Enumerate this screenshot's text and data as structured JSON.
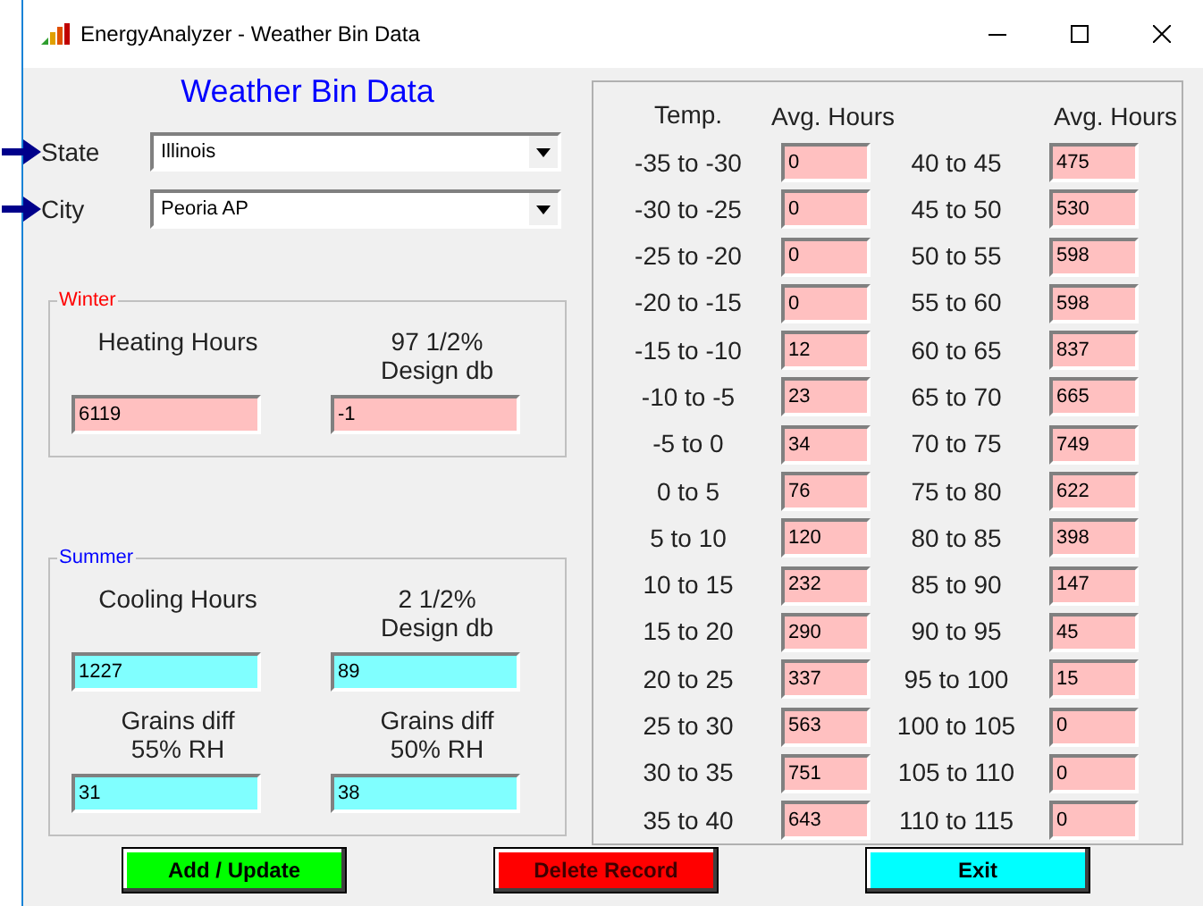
{
  "window": {
    "title": "EnergyAnalyzer - Weather Bin Data"
  },
  "heading": "Weather Bin Data",
  "selectors": [
    {
      "label": "State",
      "value": "Illinois"
    },
    {
      "label": "City",
      "value": "Peoria AP"
    }
  ],
  "groups": [
    {
      "title": "Winter",
      "kind": "winter",
      "fields": [
        {
          "label": "Heating Hours",
          "value": "6119"
        },
        {
          "label": "97 1/2%\nDesign db",
          "value": "-1"
        }
      ]
    },
    {
      "title": "Summer",
      "kind": "summer",
      "fields": [
        {
          "label": "Cooling Hours",
          "value": "1227"
        },
        {
          "label": "2 1/2%\nDesign db",
          "value": "89"
        },
        {
          "label": "Grains diff\n55% RH",
          "value": "31"
        },
        {
          "label": "Grains diff\n50% RH",
          "value": "38"
        }
      ]
    }
  ],
  "bins": {
    "headers": [
      "Temp.",
      "Avg. Hours",
      "Avg. Hours"
    ],
    "rows": [
      {
        "range": "-35 to -30",
        "hours": "0"
      },
      {
        "range": "-30 to -25",
        "hours": "0"
      },
      {
        "range": "-25 to -20",
        "hours": "0"
      },
      {
        "range": "-20 to -15",
        "hours": "0"
      },
      {
        "range": "-15 to -10",
        "hours": "12"
      },
      {
        "range": "-10 to -5",
        "hours": "23"
      },
      {
        "range": "-5 to 0",
        "hours": "34"
      },
      {
        "range": "0 to 5",
        "hours": "76"
      },
      {
        "range": "5 to 10",
        "hours": "120"
      },
      {
        "range": "10 to 15",
        "hours": "232"
      },
      {
        "range": "15 to 20",
        "hours": "290"
      },
      {
        "range": "20 to 25",
        "hours": "337"
      },
      {
        "range": "25 to 30",
        "hours": "563"
      },
      {
        "range": "30 to 35",
        "hours": "751"
      },
      {
        "range": "35 to 40",
        "hours": "643"
      },
      {
        "range": "40 to 45",
        "hours": "475"
      },
      {
        "range": "45 to 50",
        "hours": "530"
      },
      {
        "range": "50 to 55",
        "hours": "598"
      },
      {
        "range": "55 to 60",
        "hours": "598"
      },
      {
        "range": "60 to 65",
        "hours": "837"
      },
      {
        "range": "65 to 70",
        "hours": "665"
      },
      {
        "range": "70 to 75",
        "hours": "749"
      },
      {
        "range": "75 to 80",
        "hours": "622"
      },
      {
        "range": "80 to 85",
        "hours": "398"
      },
      {
        "range": "85 to 90",
        "hours": "147"
      },
      {
        "range": "90 to 95",
        "hours": "45"
      },
      {
        "range": "95 to 100",
        "hours": "15"
      },
      {
        "range": "100 to 105",
        "hours": "0"
      },
      {
        "range": "105 to 110",
        "hours": "0"
      },
      {
        "range": "110 to 115",
        "hours": "0"
      }
    ]
  },
  "buttons": [
    {
      "label": "Add / Update",
      "kind": "add"
    },
    {
      "label": "Delete Record",
      "kind": "delete"
    },
    {
      "label": "Exit",
      "kind": "exit"
    }
  ]
}
